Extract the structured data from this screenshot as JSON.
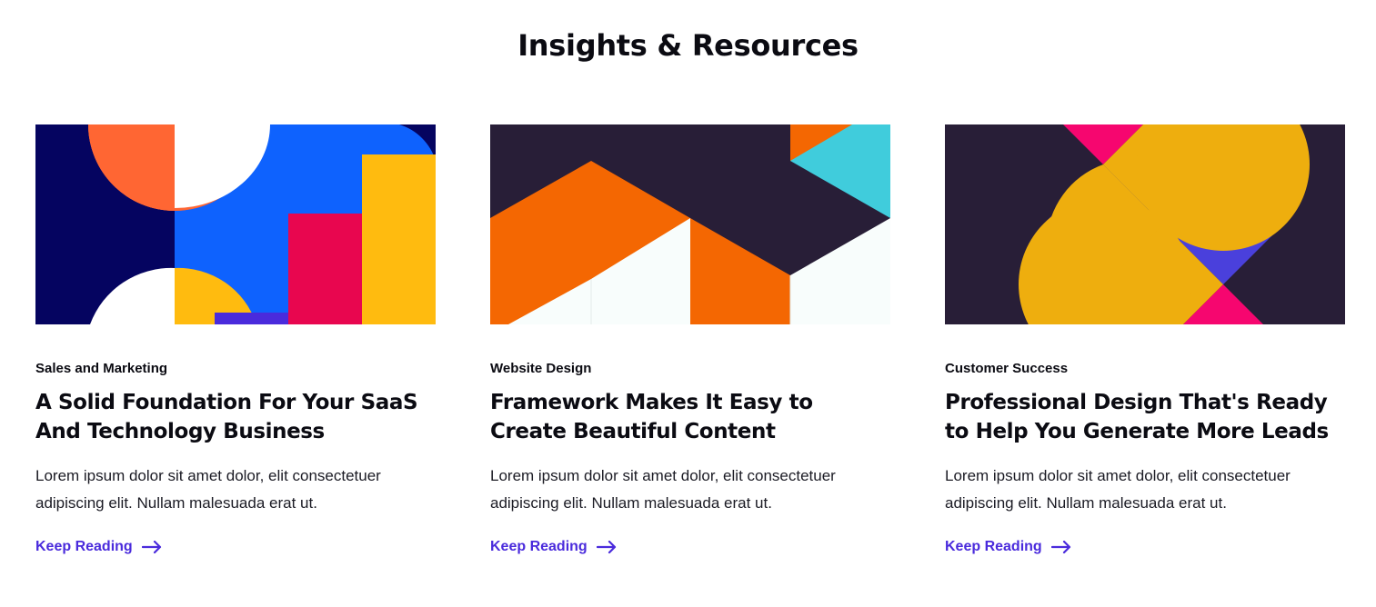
{
  "section": {
    "title": "Insights & Resources"
  },
  "cards": [
    {
      "category": "Sales and Marketing",
      "title": "A Solid Foundation For Your SaaS And Technology Business",
      "excerpt": "Lorem ipsum dolor sit amet dolor, elit consectetuer adipiscing elit. Nullam malesuada erat ut.",
      "link_label": "Keep Reading",
      "link_icon": "arrow-right-icon"
    },
    {
      "category": "Website Design",
      "title": "Framework Makes It Easy to Create Beautiful Content",
      "excerpt": "Lorem ipsum dolor sit amet dolor, elit consectetuer adipiscing elit. Nullam malesuada erat ut.",
      "link_label": "Keep Reading",
      "link_icon": "arrow-right-icon"
    },
    {
      "category": "Customer Success",
      "title": "Professional Design That's Ready to Help You Generate More Leads",
      "excerpt": "Lorem ipsum dolor sit amet dolor, elit consectetuer adipiscing elit. Nullam malesuada erat ut.",
      "link_label": "Keep Reading",
      "link_icon": "arrow-right-icon"
    }
  ],
  "colors": {
    "link": "#4a2bdc",
    "text": "#0b0b12",
    "background": "#ffffff"
  }
}
